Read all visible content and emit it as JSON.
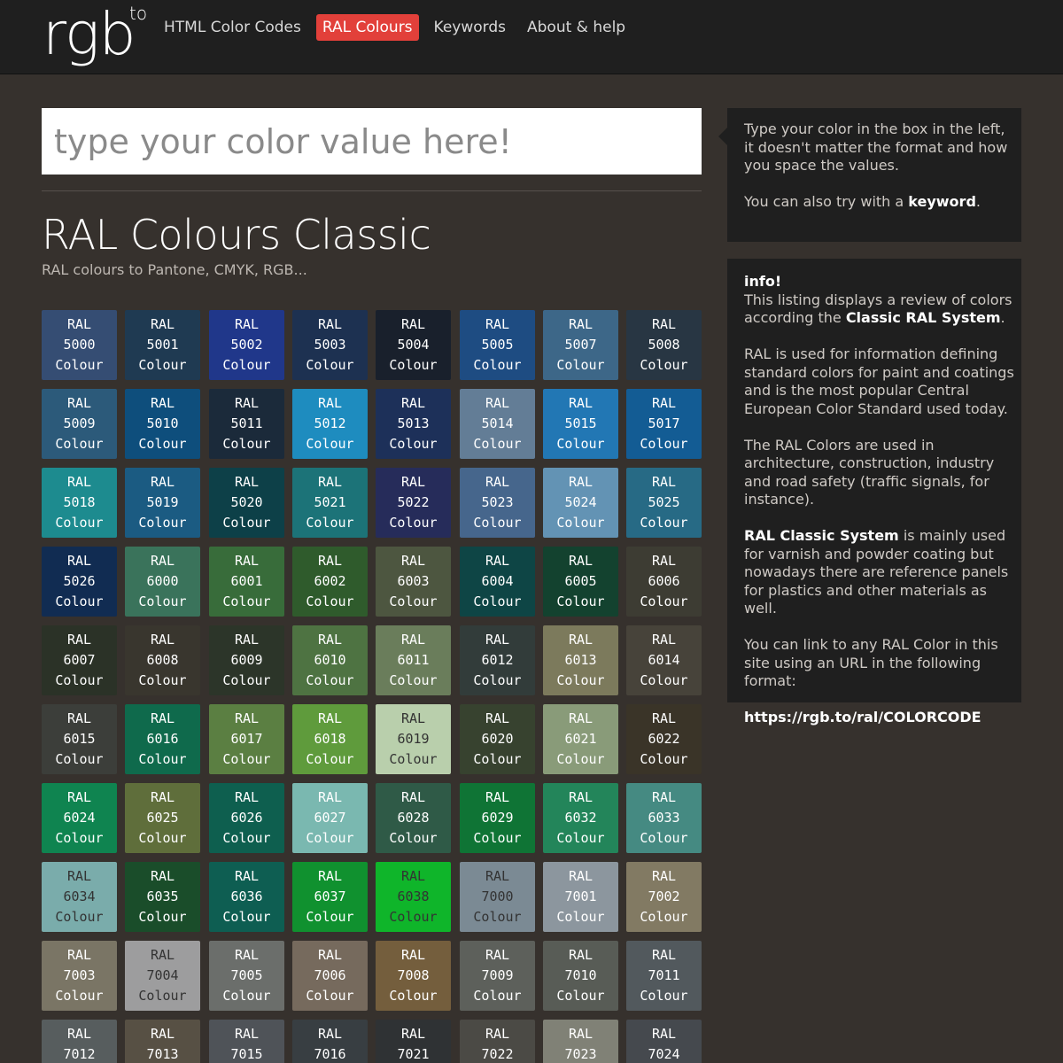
{
  "header": {
    "logo": "rgb",
    "logo_sup": "to",
    "nav": [
      {
        "label": "HTML Color Codes",
        "active": false
      },
      {
        "label": "RAL Colours",
        "active": true
      },
      {
        "label": "Keywords",
        "active": false
      },
      {
        "label": "About & help",
        "active": false
      }
    ]
  },
  "search": {
    "placeholder": "type your color value here!"
  },
  "main": {
    "title": "RAL Colours Classic",
    "subtitle": "RAL colours to Pantone, CMYK, RGB..."
  },
  "swatch_word_top": "RAL",
  "swatch_word_bottom": "Colour",
  "swatches": [
    {
      "code": "5000",
      "bg": "#354d73",
      "fg": "#ffffff"
    },
    {
      "code": "5001",
      "bg": "#1f3a52",
      "fg": "#ffffff"
    },
    {
      "code": "5002",
      "bg": "#20378a",
      "fg": "#ffffff"
    },
    {
      "code": "5003",
      "bg": "#1d3151",
      "fg": "#ffffff"
    },
    {
      "code": "5004",
      "bg": "#19202c",
      "fg": "#ffffff"
    },
    {
      "code": "5005",
      "bg": "#1e4c82",
      "fg": "#ffffff"
    },
    {
      "code": "5007",
      "bg": "#3d6788",
      "fg": "#ffffff"
    },
    {
      "code": "5008",
      "bg": "#283643",
      "fg": "#ffffff"
    },
    {
      "code": "5009",
      "bg": "#2c5a7a",
      "fg": "#ffffff"
    },
    {
      "code": "5010",
      "bg": "#0e4e7c",
      "fg": "#ffffff"
    },
    {
      "code": "5011",
      "bg": "#1b2a3a",
      "fg": "#ffffff"
    },
    {
      "code": "5012",
      "bg": "#1e8cbf",
      "fg": "#ffffff"
    },
    {
      "code": "5013",
      "bg": "#1d3059",
      "fg": "#ffffff"
    },
    {
      "code": "5014",
      "bg": "#637d96",
      "fg": "#ffffff"
    },
    {
      "code": "5015",
      "bg": "#2277b4",
      "fg": "#ffffff"
    },
    {
      "code": "5017",
      "bg": "#135c94",
      "fg": "#ffffff"
    },
    {
      "code": "5018",
      "bg": "#1d8b8f",
      "fg": "#ffffff"
    },
    {
      "code": "5019",
      "bg": "#1b5b82",
      "fg": "#ffffff"
    },
    {
      "code": "5020",
      "bg": "#0d4048",
      "fg": "#ffffff"
    },
    {
      "code": "5021",
      "bg": "#1c7378",
      "fg": "#ffffff"
    },
    {
      "code": "5022",
      "bg": "#262c5a",
      "fg": "#ffffff"
    },
    {
      "code": "5023",
      "bg": "#46668c",
      "fg": "#ffffff"
    },
    {
      "code": "5024",
      "bg": "#6393b4",
      "fg": "#ffffff"
    },
    {
      "code": "5025",
      "bg": "#276a85",
      "fg": "#ffffff"
    },
    {
      "code": "5026",
      "bg": "#112c52",
      "fg": "#ffffff"
    },
    {
      "code": "6000",
      "bg": "#3a735b",
      "fg": "#ffffff"
    },
    {
      "code": "6001",
      "bg": "#386c3a",
      "fg": "#ffffff"
    },
    {
      "code": "6002",
      "bg": "#2f5b2c",
      "fg": "#ffffff"
    },
    {
      "code": "6003",
      "bg": "#4d5640",
      "fg": "#ffffff"
    },
    {
      "code": "6004",
      "bg": "#0e4545",
      "fg": "#ffffff"
    },
    {
      "code": "6005",
      "bg": "#13422f",
      "fg": "#ffffff"
    },
    {
      "code": "6006",
      "bg": "#3d3c33",
      "fg": "#ffffff"
    },
    {
      "code": "6007",
      "bg": "#2b3227",
      "fg": "#ffffff"
    },
    {
      "code": "6008",
      "bg": "#39362e",
      "fg": "#ffffff"
    },
    {
      "code": "6009",
      "bg": "#2c3529",
      "fg": "#ffffff"
    },
    {
      "code": "6010",
      "bg": "#4e7342",
      "fg": "#ffffff"
    },
    {
      "code": "6011",
      "bg": "#6a7d5b",
      "fg": "#ffffff"
    },
    {
      "code": "6012",
      "bg": "#323c3a",
      "fg": "#ffffff"
    },
    {
      "code": "6013",
      "bg": "#7c7a5c",
      "fg": "#ffffff"
    },
    {
      "code": "6014",
      "bg": "#47433a",
      "fg": "#ffffff"
    },
    {
      "code": "6015",
      "bg": "#3c3e3a",
      "fg": "#ffffff"
    },
    {
      "code": "6016",
      "bg": "#0f6a4c",
      "fg": "#ffffff"
    },
    {
      "code": "6017",
      "bg": "#5b7f42",
      "fg": "#ffffff"
    },
    {
      "code": "6018",
      "bg": "#5f9b3c",
      "fg": "#ffffff"
    },
    {
      "code": "6019",
      "bg": "#b9cfac",
      "fg": "#333333"
    },
    {
      "code": "6020",
      "bg": "#37422f",
      "fg": "#ffffff"
    },
    {
      "code": "6021",
      "bg": "#899b79",
      "fg": "#ffffff"
    },
    {
      "code": "6022",
      "bg": "#3a3428",
      "fg": "#ffffff"
    },
    {
      "code": "6024",
      "bg": "#0f8450",
      "fg": "#ffffff"
    },
    {
      "code": "6025",
      "bg": "#5f6e3b",
      "fg": "#ffffff"
    },
    {
      "code": "6026",
      "bg": "#0e5f4f",
      "fg": "#ffffff"
    },
    {
      "code": "6027",
      "bg": "#7ab8b0",
      "fg": "#ffffff"
    },
    {
      "code": "6028",
      "bg": "#2f5a47",
      "fg": "#ffffff"
    },
    {
      "code": "6029",
      "bg": "#0f7435",
      "fg": "#ffffff"
    },
    {
      "code": "6032",
      "bg": "#23855a",
      "fg": "#ffffff"
    },
    {
      "code": "6033",
      "bg": "#458a82",
      "fg": "#ffffff"
    },
    {
      "code": "6034",
      "bg": "#7aacab",
      "fg": "#333333"
    },
    {
      "code": "6035",
      "bg": "#1a4d2a",
      "fg": "#ffffff"
    },
    {
      "code": "6036",
      "bg": "#0e5e52",
      "fg": "#ffffff"
    },
    {
      "code": "6037",
      "bg": "#10912f",
      "fg": "#ffffff"
    },
    {
      "code": "6038",
      "bg": "#0fb52a",
      "fg": "#333333"
    },
    {
      "code": "7000",
      "bg": "#7b8a94",
      "fg": "#333333"
    },
    {
      "code": "7001",
      "bg": "#8c969e",
      "fg": "#ffffff"
    },
    {
      "code": "7002",
      "bg": "#827a63",
      "fg": "#ffffff"
    },
    {
      "code": "7003",
      "bg": "#7a7565",
      "fg": "#ffffff"
    },
    {
      "code": "7004",
      "bg": "#9d9d9e",
      "fg": "#333333"
    },
    {
      "code": "7005",
      "bg": "#6b6e6b",
      "fg": "#ffffff"
    },
    {
      "code": "7006",
      "bg": "#766a5d",
      "fg": "#ffffff"
    },
    {
      "code": "7008",
      "bg": "#745e3d",
      "fg": "#ffffff"
    },
    {
      "code": "7009",
      "bg": "#5d605b",
      "fg": "#ffffff"
    },
    {
      "code": "7010",
      "bg": "#585c56",
      "fg": "#ffffff"
    },
    {
      "code": "7011",
      "bg": "#52595d",
      "fg": "#ffffff"
    },
    {
      "code": "7012",
      "bg": "#575d5e",
      "fg": "#ffffff"
    },
    {
      "code": "7013",
      "bg": "#575044",
      "fg": "#ffffff"
    },
    {
      "code": "7015",
      "bg": "#4f5358",
      "fg": "#ffffff"
    },
    {
      "code": "7016",
      "bg": "#383e42",
      "fg": "#ffffff"
    },
    {
      "code": "7021",
      "bg": "#2f3234",
      "fg": "#ffffff"
    },
    {
      "code": "7022",
      "bg": "#4b4a45",
      "fg": "#ffffff"
    },
    {
      "code": "7023",
      "bg": "#808176",
      "fg": "#ffffff"
    },
    {
      "code": "7024",
      "bg": "#45494e",
      "fg": "#ffffff"
    }
  ],
  "sidebar": {
    "hint": {
      "text": "Type your color in the box in the left, it doesn't matter the format and how you space the values.",
      "pre": "You can also try with a ",
      "link": "keyword",
      "post": "."
    },
    "info": {
      "heading": "info!",
      "intro_pre": "This listing displays a review of colors according the ",
      "intro_bold": "Classic RAL System",
      "intro_post": ".",
      "p2": "RAL is used for information defining standard colors for paint and coatings and is the most popular Central European Color Standard used today.",
      "p3": "The RAL Colors are used in architecture, construction, industry and road safety (traffic signals, for instance).",
      "p4_bold": "RAL Classic System",
      "p4_rest": " is mainly used for varnish and powder coating but nowadays there are reference panels for plastics and other materials as well.",
      "p5": "You can link to any RAL Color in this site using an URL in the following format:",
      "url": "https://rgb.to/ral/COLORCODE"
    }
  }
}
